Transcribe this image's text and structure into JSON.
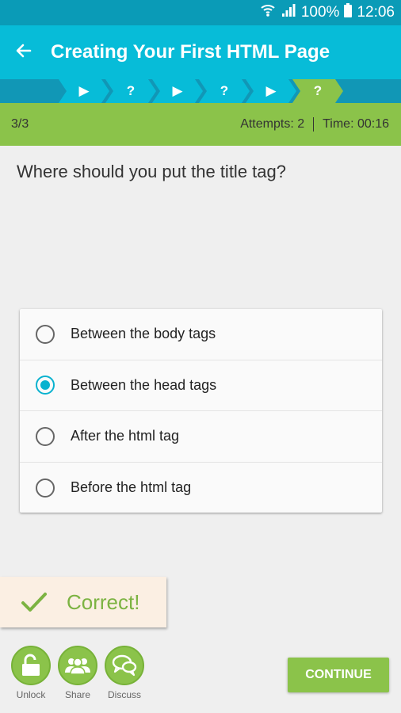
{
  "status_bar": {
    "battery": "100%",
    "time": "12:06",
    "icons": [
      "wifi-icon",
      "signal-icon",
      "battery-icon"
    ]
  },
  "app_bar": {
    "title": "Creating Your First HTML Page",
    "back_icon": "arrow-left-icon"
  },
  "steps": [
    {
      "label": "▶",
      "type": "lesson"
    },
    {
      "label": "?",
      "type": "quiz"
    },
    {
      "label": "▶",
      "type": "lesson"
    },
    {
      "label": "?",
      "type": "quiz"
    },
    {
      "label": "▶",
      "type": "lesson"
    },
    {
      "label": "?",
      "type": "quiz",
      "current": true
    }
  ],
  "info": {
    "progress": "3/3",
    "attempts": "Attempts: 2",
    "time": "Time: 00:16"
  },
  "question": "Where should you put the title tag?",
  "options": [
    {
      "label": "Between the body tags",
      "selected": false
    },
    {
      "label": "Between the head tags",
      "selected": true
    },
    {
      "label": "After the html tag",
      "selected": false
    },
    {
      "label": "Before the html tag",
      "selected": false
    }
  ],
  "feedback": {
    "text": "Correct!",
    "icon": "checkmark-icon"
  },
  "actions": [
    {
      "label": "Unlock",
      "icon": "unlock-icon"
    },
    {
      "label": "Share",
      "icon": "people-icon"
    },
    {
      "label": "Discuss",
      "icon": "chat-bubbles-icon"
    }
  ],
  "continue_label": "CONTINUE",
  "colors": {
    "status_bar": "#0a9bb7",
    "app_bar": "#07bcd8",
    "stepper_bg": "#1197b6",
    "step": "#07bcd8",
    "step_current": "#8bc34a",
    "accent_green": "#8bc34a",
    "radio_selected": "#08b2cf"
  }
}
